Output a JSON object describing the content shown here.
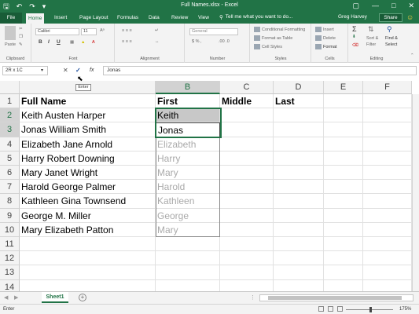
{
  "titlebar": {
    "title": "Full Names.xlsx - Excel",
    "qat_save_icon": "save-icon",
    "qat_undo_icon": "undo-icon",
    "qat_redo_icon": "redo-icon"
  },
  "tabs": {
    "file": "File",
    "items": [
      "Home",
      "Insert",
      "Page Layout",
      "Formulas",
      "Data",
      "Review",
      "View"
    ],
    "tell_me": "Tell me what you want to do...",
    "user": "Greg Harvey",
    "share": "Share"
  },
  "ribbon": {
    "clipboard": {
      "label": "Clipboard",
      "paste": "Paste"
    },
    "font": {
      "label": "Font",
      "name": "Calibri",
      "size": "11"
    },
    "alignment": {
      "label": "Alignment"
    },
    "number": {
      "label": "Number",
      "format": "General"
    },
    "styles": {
      "label": "Styles",
      "conditional": "Conditional Formatting",
      "format_table": "Format as Table",
      "cell_styles": "Cell Styles"
    },
    "cells": {
      "label": "Cells",
      "insert": "Insert",
      "delete": "Delete",
      "format": "Format"
    },
    "editing": {
      "label": "Editing",
      "sort": "Sort &",
      "filter": "Filter",
      "find": "Find &",
      "select": "Select"
    }
  },
  "formula_bar": {
    "name_box": "2R x 1C",
    "fx": "fx",
    "value": "Jonas",
    "tooltip": "Enter"
  },
  "grid": {
    "columns": [
      "B",
      "C",
      "D",
      "E",
      "F"
    ],
    "rows": [
      "1",
      "2",
      "3",
      "4",
      "5",
      "6",
      "7",
      "8",
      "9",
      "10",
      "11",
      "12",
      "13",
      "14"
    ],
    "col_a": [
      "Full Name",
      "Keith Austen Harper",
      "Jonas William Smith",
      "Elizabeth Jane Arnold",
      "Harry Robert Downing",
      "Mary Janet Wright",
      "Harold George Palmer",
      "Kathleen Gina Townsend",
      "George M. Miller",
      "Mary Elizabeth Patton"
    ],
    "col_b": [
      "First",
      "Keith",
      "Jonas",
      "Elizabeth",
      "Harry",
      "Mary",
      "Harold",
      "Kathleen",
      "George",
      "Mary"
    ],
    "col_c_header": "Middle",
    "col_d_header": "Last"
  },
  "sheets": {
    "active": "Sheet1"
  },
  "status": {
    "mode": "Enter",
    "zoom": "175%"
  }
}
